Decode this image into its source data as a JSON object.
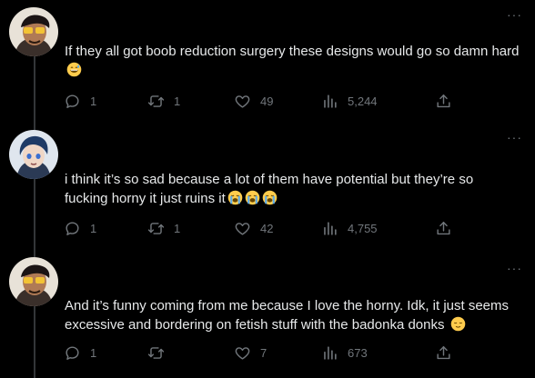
{
  "theme": {
    "background": "#000000",
    "text": "#e7e9ea",
    "muted": "#71767b",
    "line": "#333639"
  },
  "tweets": [
    {
      "text": "If they all got boob reduction surgery these designs would go so damn hard",
      "emoji": [
        "grinning-sweat-emoji"
      ],
      "reply_count": "1",
      "retweet_count": "1",
      "like_count": "49",
      "view_count": "5,244"
    },
    {
      "text": "i think it’s so sad because a lot of them have potential but they’re so fucking horny it just ruins it",
      "emoji": [
        "loudly-crying-emoji",
        "loudly-crying-emoji",
        "loudly-crying-emoji"
      ],
      "reply_count": "1",
      "retweet_count": "1",
      "like_count": "42",
      "view_count": "4,755"
    },
    {
      "text": "And it’s funny coming from me because I love the horny. Idk, it just seems excessive and bordering on fetish stuff with the badonka donks",
      "emoji": [
        "relieved-face-emoji"
      ],
      "reply_count": "1",
      "retweet_count": "",
      "like_count": "7",
      "view_count": "673"
    }
  ],
  "more_label": "···"
}
